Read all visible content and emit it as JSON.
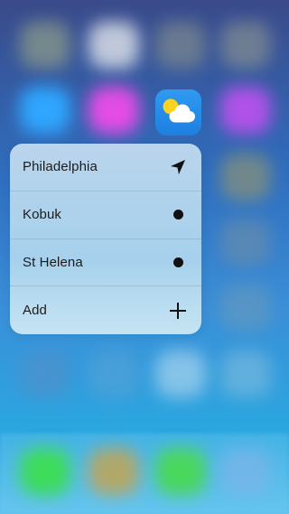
{
  "home_screen": {
    "app_icon": "weather-app-icon"
  },
  "quick_actions": {
    "items": [
      {
        "label": "Philadelphia",
        "icon": "location-arrow-icon"
      },
      {
        "label": "Kobuk",
        "icon": "dot-icon"
      },
      {
        "label": "St Helena",
        "icon": "dot-icon"
      },
      {
        "label": "Add",
        "icon": "plus-icon"
      }
    ]
  }
}
